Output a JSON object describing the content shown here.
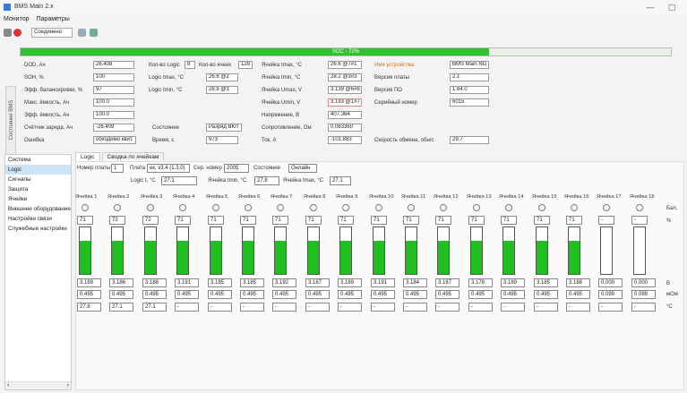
{
  "window": {
    "title": "BMS Main 2.x",
    "min_icon": "minimize-icon",
    "max_icon": "maximize-icon"
  },
  "menu": [
    "Монитор",
    "Параметры"
  ],
  "toolbar": {
    "connect_label": "Соединено",
    "icons": [
      "settings-icon",
      "stop-icon",
      "connection-icon",
      "refresh-icon"
    ]
  },
  "soc": {
    "label": "SOC - 72%",
    "value": 72
  },
  "side_label": "Состояние BMS",
  "status": {
    "col1": [
      {
        "label": "DOD, Ач",
        "value": "26.408"
      },
      {
        "label": "SOH, %",
        "value": "100"
      },
      {
        "label": "Эфф. балансировки, %",
        "value": "97"
      },
      {
        "label": "Макс. ёмкость, Ач",
        "value": "100.0"
      },
      {
        "label": "Эфф. ёмкость, Ач",
        "value": "100.0"
      },
      {
        "label": "Счётчик заряда, Ач",
        "value": "-26.409"
      },
      {
        "label": "Ошибка",
        "value": "обходимо квит."
      }
    ],
    "col2": [
      {
        "label": "Кол-во Logic",
        "value": "8"
      },
      {
        "label": "Кол-во ячеек",
        "value": "128"
      },
      {
        "label": "Logic tmax, °C",
        "value": "26.6 @2"
      },
      {
        "label": "Logic tmin, °C",
        "value": "28.8 @3"
      },
      {
        "label": "Состояние",
        "value": "Разряд ВКЛ"
      },
      {
        "label": "Время, с",
        "value": "973"
      }
    ],
    "col3": [
      {
        "label": "Ячейка tmax, °C",
        "value": "26.6 @7#1"
      },
      {
        "label": "Ячейка tmin, °C",
        "value": "28.2 @3#3"
      },
      {
        "label": "Ячейка Umax, V",
        "value": "3.139 @6#6"
      },
      {
        "label": "Ячейка Umin, V",
        "value": "3.193 @1#7"
      },
      {
        "label": "Напряжение, В",
        "value": "407.364"
      },
      {
        "label": "Сопротивление, Ом",
        "value": "0.063360"
      },
      {
        "label": "Ток, А",
        "value": "-101.883"
      }
    ],
    "col4": [
      {
        "label": "Имя устройства",
        "value": "BMS Main NG"
      },
      {
        "label": "Версия платы",
        "value": "2.1"
      },
      {
        "label": "Версия ПО",
        "value": "1.64.0"
      },
      {
        "label": "Серийный номер",
        "value": "6015"
      },
      {
        "label": "Скорость обмена, обн/с",
        "value": "29.7"
      }
    ]
  },
  "nav": [
    "Система",
    "Logic",
    "Сигналы",
    "Защита",
    "Ячейки",
    "Внешнее оборудование",
    "Настройки связи",
    "Служебные настройки"
  ],
  "nav_selected": 1,
  "tabs": [
    "Logic",
    "Сводка по ячейкам"
  ],
  "logic": {
    "board_label": "Номер платы",
    "board_value": "1",
    "plata_label": "Плата",
    "plata_value": "ек, v3.4 (1.3.0)",
    "serial_label": "Сер. номер",
    "serial_value": "2005",
    "state_label": "Состояние",
    "state_value": "Онлайн",
    "tlogic_label": "Logic t, °C",
    "tlogic_value": "27.1",
    "tcell_min_label": "Ячейка tmin, °C",
    "tcell_min_value": "27.8",
    "tcell_max_label": "Ячейка tmax, °C",
    "tcell_max_value": "27.1"
  },
  "cells": [
    {
      "name": "Ячейка 1",
      "soc": "71",
      "fill": 0.71,
      "u": "3.189",
      "r": "0.495",
      "t": "27.8"
    },
    {
      "name": "Ячейка 2",
      "soc": "72",
      "fill": 0.72,
      "u": "3.186",
      "r": "0.495",
      "t": "27.1"
    },
    {
      "name": "Ячейка 3",
      "soc": "72",
      "fill": 0.72,
      "u": "3.188",
      "r": "0.495",
      "t": "27.1"
    },
    {
      "name": "Ячейка 4",
      "soc": "71",
      "fill": 0.71,
      "u": "3.191",
      "r": "0.495",
      "t": "-"
    },
    {
      "name": "Ячейка 5",
      "soc": "71",
      "fill": 0.71,
      "u": "3.185",
      "r": "0.495",
      "t": "-"
    },
    {
      "name": "Ячейка 6",
      "soc": "71",
      "fill": 0.71,
      "u": "3.185",
      "r": "0.495",
      "t": "-"
    },
    {
      "name": "Ячейка 7",
      "soc": "71",
      "fill": 0.71,
      "u": "3.192",
      "r": "0.495",
      "t": "-"
    },
    {
      "name": "Ячейка 8",
      "soc": "71",
      "fill": 0.71,
      "u": "3.187",
      "r": "0.495",
      "t": "-"
    },
    {
      "name": "Ячейка 9",
      "soc": "71",
      "fill": 0.71,
      "u": "3.189",
      "r": "0.495",
      "t": "-"
    },
    {
      "name": "Ячейка 10",
      "soc": "71",
      "fill": 0.71,
      "u": "3.191",
      "r": "0.495",
      "t": "-"
    },
    {
      "name": "Ячейка 11",
      "soc": "71",
      "fill": 0.71,
      "u": "3.184",
      "r": "0.495",
      "t": "-"
    },
    {
      "name": "Ячейка 12",
      "soc": "71",
      "fill": 0.71,
      "u": "3.187",
      "r": "0.495",
      "t": "-"
    },
    {
      "name": "Ячейка 13",
      "soc": "71",
      "fill": 0.71,
      "u": "3.178",
      "r": "0.495",
      "t": "-"
    },
    {
      "name": "Ячейка 14",
      "soc": "71",
      "fill": 0.71,
      "u": "3.189",
      "r": "0.495",
      "t": "-"
    },
    {
      "name": "Ячейка 15",
      "soc": "71",
      "fill": 0.71,
      "u": "3.185",
      "r": "0.495",
      "t": "-"
    },
    {
      "name": "Ячейка 16",
      "soc": "71",
      "fill": 0.71,
      "u": "3.188",
      "r": "0.495",
      "t": "-"
    },
    {
      "name": "Ячейка 17",
      "soc": "-",
      "fill": 0,
      "u": "0.000",
      "r": "0.099",
      "t": "-"
    },
    {
      "name": "Ячейка 18",
      "soc": "-",
      "fill": 0,
      "u": "0.000",
      "r": "0.099",
      "t": "-"
    }
  ],
  "units": {
    "bal": "Бал.",
    "soc": "%",
    "u": "В",
    "r": "мОм",
    "t": "°C"
  },
  "nav_scroll": {
    "left": "‹",
    "right": "›"
  },
  "colors": {
    "accent": "#2fc42f",
    "highlight": "#c8741a",
    "selected": "#cfe3f7"
  }
}
